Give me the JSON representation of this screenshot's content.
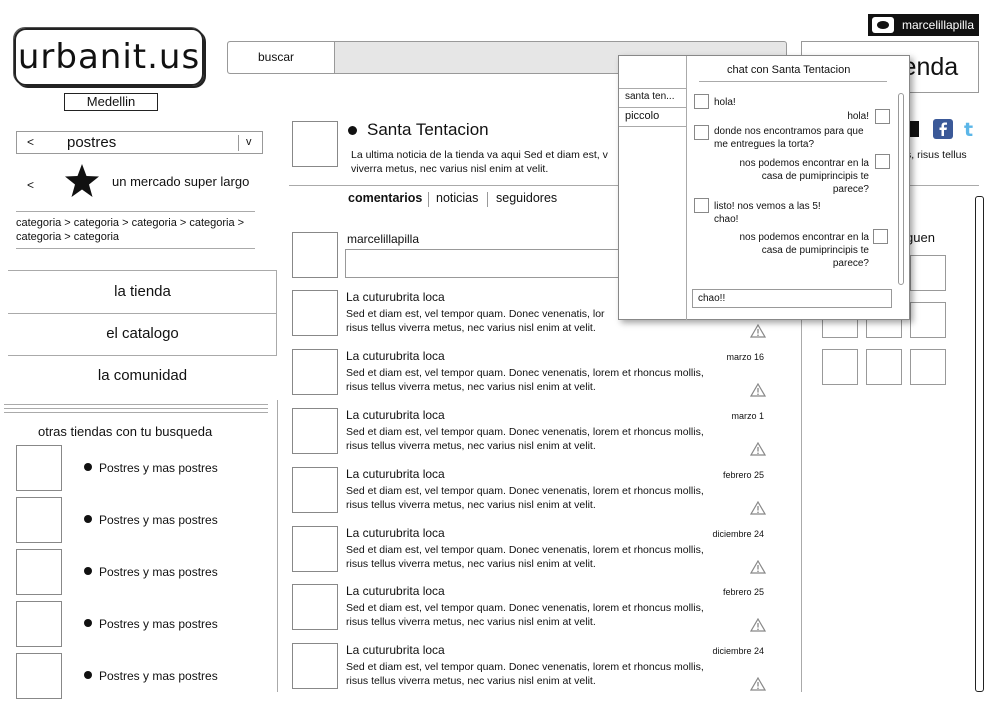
{
  "header": {
    "logo_text": "urbanit.us",
    "city": "Medellin",
    "search_button": "buscar",
    "search_placeholder": "",
    "user_name": "marcelillapilla",
    "tienda_label": "ienda"
  },
  "sidebar": {
    "category_select": {
      "prev": "<",
      "value": "postres",
      "arrow": "v"
    },
    "featured": {
      "prev": "<",
      "label": "un mercado super largo"
    },
    "breadcrumb": "categoria > categoria > categoria > categoria > categoria > categoria",
    "nav": [
      "la tienda",
      "el catalogo",
      "la comunidad"
    ],
    "otras_title": "otras tiendas con tu busqueda",
    "otras_items": [
      "Postres y mas postres",
      "Postres y mas postres",
      "Postres y mas postres",
      "Postres y mas postres",
      "Postres y mas postres"
    ]
  },
  "store": {
    "name": "Santa Tentacion",
    "news": "La ultima noticia de la tienda va aqui Sed et diam est, v",
    "news_line2": "viverra metus, nec varius nisl enim at velit.",
    "news_right": "s, risus tellus"
  },
  "tabs": [
    "comentarios",
    "noticias",
    "seguidores"
  ],
  "composer": {
    "user": "marcelillapilla",
    "placeholder": ""
  },
  "comments": [
    {
      "name": "La cuturubrita loca",
      "date": "",
      "line1": "Sed et diam est, vel tempor quam. Donec venenatis, lor",
      "line2": "risus tellus viverra metus, nec varius nisl enim at velit."
    },
    {
      "name": "La cuturubrita loca",
      "date": "marzo 16",
      "line1": "Sed et diam est, vel tempor quam. Donec venenatis, lorem et rhoncus mollis,",
      "line2": "risus tellus viverra metus, nec varius nisl enim at velit."
    },
    {
      "name": "La cuturubrita loca",
      "date": "marzo 1",
      "line1": "Sed et diam est, vel tempor quam. Donec venenatis, lorem et rhoncus mollis,",
      "line2": "risus tellus viverra metus, nec varius nisl enim at velit."
    },
    {
      "name": "La cuturubrita loca",
      "date": "febrero 25",
      "line1": "Sed et diam est, vel tempor quam. Donec venenatis, lorem et rhoncus mollis,",
      "line2": "risus tellus viverra metus, nec varius nisl enim at velit."
    },
    {
      "name": "La cuturubrita loca",
      "date": "diciembre 24",
      "line1": "Sed et diam est, vel tempor quam. Donec venenatis, lorem et rhoncus mollis,",
      "line2": "risus tellus viverra metus, nec varius nisl enim at velit."
    },
    {
      "name": "La cuturubrita loca",
      "date": "febrero 25",
      "line1": "Sed et diam est, vel tempor quam. Donec venenatis, lorem et rhoncus mollis,",
      "line2": "risus tellus viverra metus, nec varius nisl enim at velit."
    },
    {
      "name": "La cuturubrita loca",
      "date": "diciembre 24",
      "line1": "Sed et diam est, vel tempor quam. Donec venenatis, lorem et rhoncus mollis,",
      "line2": "risus tellus viverra metus, nec varius nisl enim at velit."
    }
  ],
  "right_panel": {
    "followers_label": "guen"
  },
  "chat": {
    "title": "chat con Santa Tentacion",
    "contacts": [
      "santa ten...",
      "piccolo"
    ],
    "messages": [
      {
        "side": "left",
        "text": "hola!"
      },
      {
        "side": "right",
        "text": "hola!"
      },
      {
        "side": "left",
        "text": "donde nos encontramos para que me entregues la torta?"
      },
      {
        "side": "right",
        "text": "nos podemos encontrar en la casa de pumiprincipis te parece?"
      },
      {
        "side": "left",
        "text": "listo! nos vemos a las 5! chao!"
      },
      {
        "side": "right",
        "text": "nos podemos encontrar en la casa de pumiprincipis te parece?"
      }
    ],
    "input_value": "chao!!"
  }
}
